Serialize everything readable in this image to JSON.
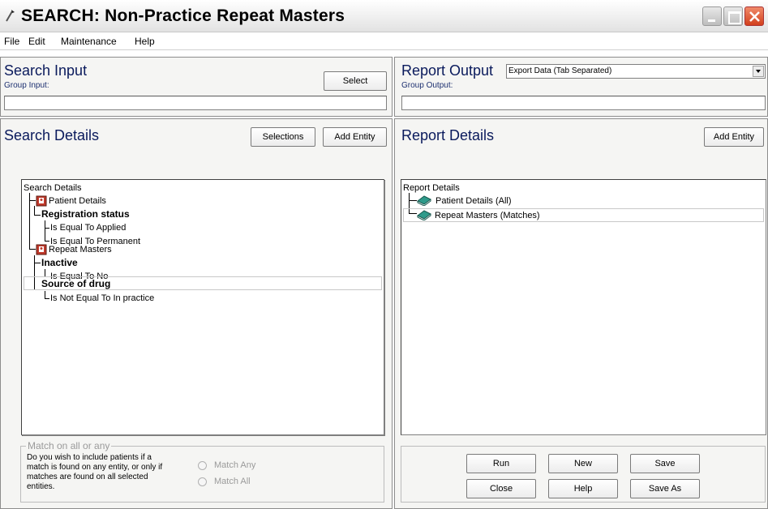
{
  "window": {
    "title": "SEARCH: Non-Practice Repeat Masters"
  },
  "menu": [
    "File",
    "Edit",
    "Maintenance",
    "Help"
  ],
  "search_input": {
    "title": "Search Input",
    "group_label": "Group Input:",
    "group_value": "",
    "select_button": "Select"
  },
  "report_output": {
    "title": "Report Output",
    "format_selected": "Export Data (Tab Separated)",
    "group_label": "Group Output:",
    "group_value": ""
  },
  "search_details": {
    "title": "Search Details",
    "selections_button": "Selections",
    "add_entity_button": "Add Entity",
    "tree": [
      {
        "text": "Search Details",
        "bold": false
      },
      {
        "text": "Patient Details",
        "bold": false
      },
      {
        "text": "Registration status",
        "bold": true
      },
      {
        "text": "Is Equal To Applied",
        "bold": false
      },
      {
        "text": "Is Equal To Permanent",
        "bold": false
      },
      {
        "text": "Repeat Masters",
        "bold": false
      },
      {
        "text": "Inactive",
        "bold": true
      },
      {
        "text": "Is Equal To No",
        "bold": false
      },
      {
        "text": "Source of drug",
        "bold": true
      },
      {
        "text": "Is Not Equal To In practice",
        "bold": false
      }
    ]
  },
  "report_details": {
    "title": "Report Details",
    "add_entity_button": "Add Entity",
    "tree": [
      {
        "text": "Report Details"
      },
      {
        "text": "Patient Details (All)"
      },
      {
        "text": "Repeat Masters (Matches)"
      }
    ]
  },
  "match_group": {
    "legend": "Match on all or any",
    "description": "Do you wish to include patients if a match is found on any entity, or only if matches are found on all selected entities.",
    "desc_lines": [
      "Do you wish to include patients if a",
      "match is found on any entity, or only if",
      "matches are found on all selected",
      "entities."
    ],
    "option_any": "Match Any",
    "option_all": "Match All"
  },
  "actions": {
    "run": "Run",
    "new": "New",
    "save": "Save",
    "close": "Close",
    "help": "Help",
    "save_as": "Save As"
  }
}
